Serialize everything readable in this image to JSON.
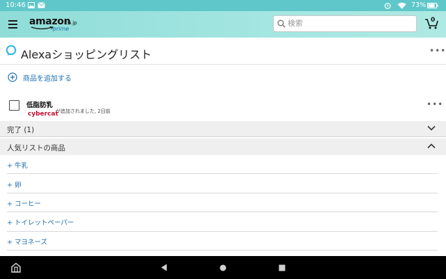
{
  "status_bar": {
    "time": "10:46",
    "battery": "73%"
  },
  "header": {
    "logo_word": "amazon",
    "logo_suffix": ".co.jp",
    "logo_prime": "prime",
    "search_placeholder": "検索",
    "cart_count": "0"
  },
  "list": {
    "title": "Alexaショッピングリスト",
    "add_item_label": "商品を追加する",
    "items": [
      {
        "name": "低脂肪乳",
        "added_by": "cybercat",
        "meta": "が追加されました, 2日前",
        "checked": false
      }
    ],
    "completed_label": "完了 (1)",
    "popular_label": "人気リストの商品",
    "popular_items": [
      "+ 牛乳",
      "+ 卵",
      "+ コーヒー",
      "+ トイレットペーパー",
      "+ マヨネーズ"
    ]
  },
  "colors": {
    "status_bar": "#5fc7c9",
    "header": "#a4e6e1",
    "link": "#1f6fb2",
    "added_by": "#c8102e"
  }
}
